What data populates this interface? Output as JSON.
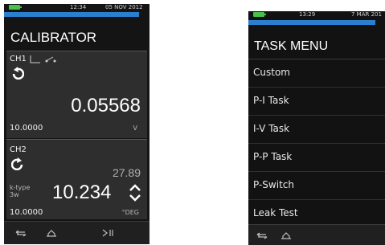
{
  "calibrator": {
    "status": {
      "time": "12:34",
      "date": "05 NOV 2012"
    },
    "title": "CALIBRATOR",
    "ch1": {
      "label": "CH1",
      "value": "0.05568",
      "range": "10.0000",
      "unit": "V"
    },
    "ch2": {
      "label": "CH2",
      "secondary_value": "27.89",
      "sensor_type": "k-type",
      "wires": "3w",
      "value": "10.234",
      "range": "10.0000",
      "unit": "°DEG"
    }
  },
  "task_menu": {
    "status": {
      "time": "13:29",
      "date": "7 MAR 201"
    },
    "title": "TASK MENU",
    "items": [
      "Custom",
      "P-I Task",
      "I-V Task",
      "P-P Task",
      "P-Switch",
      "Leak Test"
    ]
  },
  "colors": {
    "battery": "#49c04a",
    "accent_bar": "#2a7fcf",
    "screen_bg": "#141414"
  }
}
